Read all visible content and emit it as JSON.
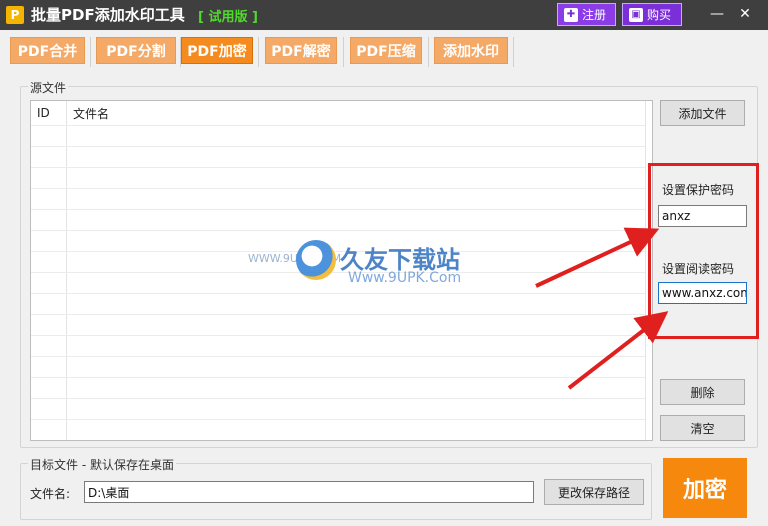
{
  "titlebar": {
    "app_icon": "P",
    "title": "批量PDF添加水印工具",
    "trial_tag": "[ 试用版 ]",
    "register_label": "注册",
    "buy_label": "购买",
    "minimize_glyph": "—",
    "close_glyph": "✕"
  },
  "tabs": [
    {
      "label": "PDF合并"
    },
    {
      "label": "PDF分割"
    },
    {
      "label": "PDF加密",
      "active": true
    },
    {
      "label": "PDF解密"
    },
    {
      "label": "PDF压缩"
    },
    {
      "label": "添加水印"
    }
  ],
  "source": {
    "group_title": "源文件",
    "columns": [
      "ID",
      "文件名"
    ],
    "add_file_label": "添加文件",
    "delete_label": "删除",
    "clear_label": "清空"
  },
  "password": {
    "protect_label": "设置保护密码",
    "protect_value": "anxz",
    "read_label": "设置阅读密码",
    "read_value": "www.anxz.com"
  },
  "watermark": {
    "brand": "久友下载站",
    "url": "Www.9UPK.Com",
    "small": "WWW.9UPK.COM"
  },
  "target": {
    "group_title": "目标文件 - 默认保存在桌面",
    "filename_label": "文件名:",
    "filename_value": "D:\\桌面",
    "change_path_label": "更改保存路径"
  },
  "encrypt_label": "加密",
  "colors": {
    "accent": "#f58b1f",
    "highlight": "#e01f1f",
    "titlebar": "#3f3f3f"
  }
}
